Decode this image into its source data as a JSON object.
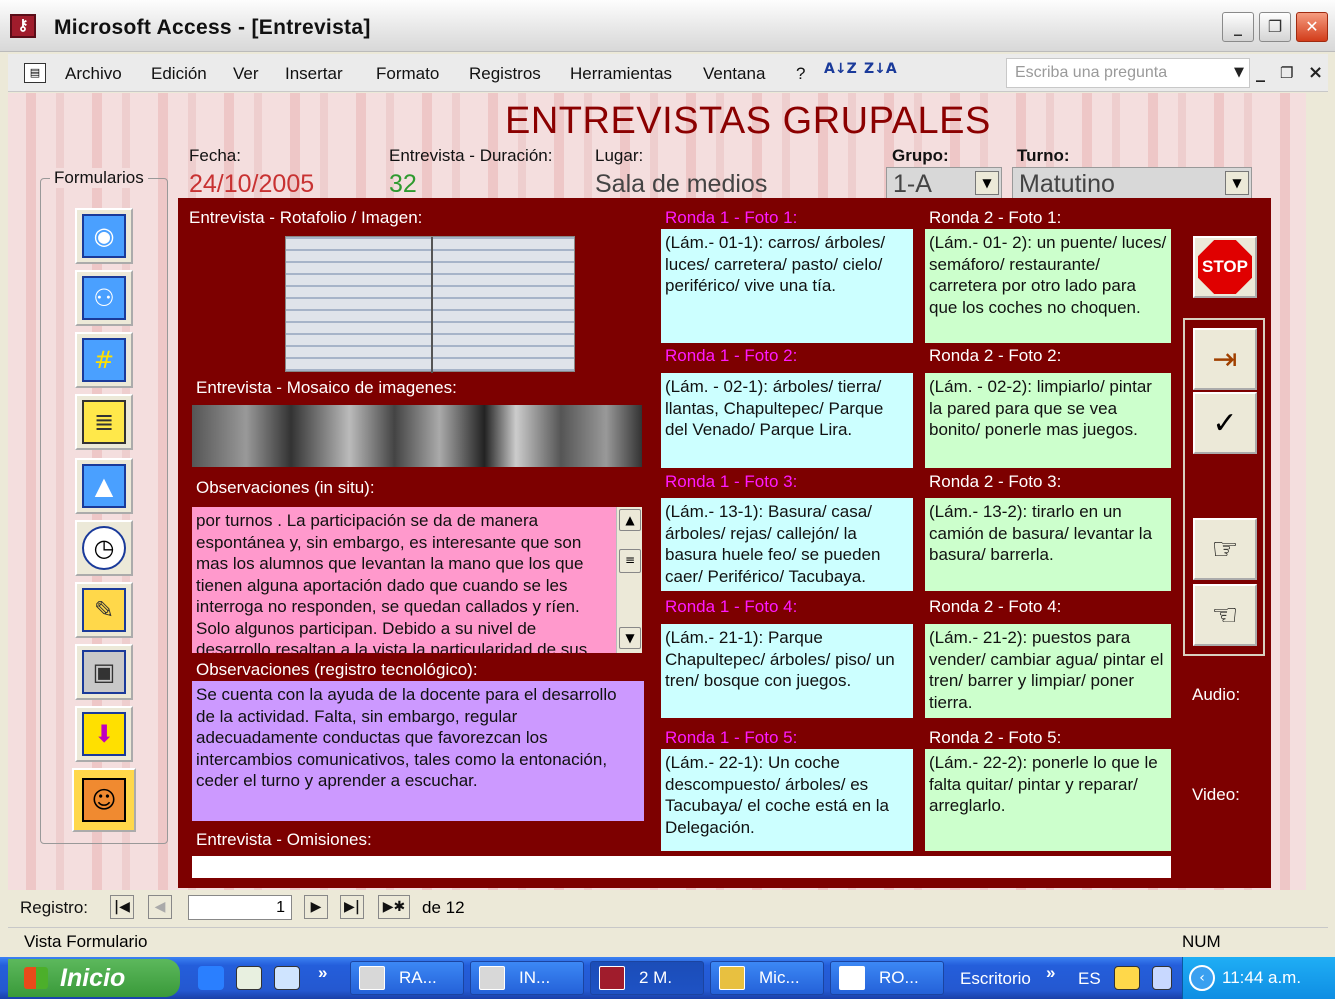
{
  "window": {
    "title": "Microsoft Access - [Entrevista]",
    "minimize": "_",
    "restore": "❐",
    "close": "✕"
  },
  "menubar": {
    "items": [
      "Archivo",
      "Edición",
      "Ver",
      "Insertar",
      "Formato",
      "Registros",
      "Herramientas",
      "Ventana",
      "?"
    ],
    "help_placeholder": "Escriba una pregunta",
    "sort_asc": "A↓Z",
    "sort_desc": "Z↓A"
  },
  "form": {
    "title": "ENTREVISTAS GRUPALES",
    "fecha_label": "Fecha:",
    "fecha_value": "24/10/2005",
    "duracion_label": "Entrevista - Duración:",
    "duracion_value": "32",
    "lugar_label": "Lugar:",
    "lugar_value": "Sala de medios",
    "grupo_label": "Grupo:",
    "grupo_value": "1-A",
    "turno_label": "Turno:",
    "turno_value": "Matutino",
    "sidebar_label": "Formularios",
    "rotafolio_label": "Entrevista - Rotafolio / Imagen:",
    "mosaico_label": "Entrevista - Mosaico de imagenes:",
    "obs_situ_label": "Observaciones (in situ):",
    "obs_situ_text": "por turnos . La participación se da de manera espontánea y, sin embargo, es interesante que son mas los alumnos que levantan la mano que los que tienen alguna aportación dado que cuando se les interroga no responden, se quedan callados y ríen. Solo algunos participan. Debido a su nivel de desarrollo resaltan a la vista la particularidad de sus",
    "obs_tec_label": "Observaciones (registro tecnológico):",
    "obs_tec_text": "Se cuenta con la ayuda de la docente para el desarrollo de la actividad. Falta, sin embargo, regular adecuadamente conductas que favorezcan los intercambios comunicativos, tales como la entonación, ceder el turno y aprender a escuchar.",
    "omisiones_label": "Entrevista - Omisiones:",
    "ronda1": [
      {
        "label": "Ronda 1 - Foto 1:",
        "text": "(Lám.- 01-1): carros/ árboles/ luces/ carretera/ pasto/ cielo/ periférico/ vive una tía."
      },
      {
        "label": "Ronda 1 - Foto 2:",
        "text": "(Lám. - 02-1): árboles/ tierra/ llantas, Chapultepec/ Parque del Venado/ Parque Lira."
      },
      {
        "label": "Ronda 1 - Foto 3:",
        "text": "(Lám.- 13-1): Basura/ casa/ árboles/ rejas/ callejón/ la basura huele feo/ se pueden caer/  Periférico/ Tacubaya."
      },
      {
        "label": "Ronda 1 - Foto 4:",
        "text": "(Lám.- 21-1): Parque Chapultepec/ árboles/ piso/ un tren/ bosque con juegos."
      },
      {
        "label": "Ronda 1 - Foto 5:",
        "text": "(Lám.- 22-1): Un coche descompuesto/ árboles/ es Tacubaya/ el coche está en la Delegación."
      }
    ],
    "ronda2": [
      {
        "label": "Ronda 2 - Foto 1:",
        "text": "(Lám.- 01- 2): un puente/ luces/ semáforo/ restaurante/ carretera por otro lado para que los coches no choquen."
      },
      {
        "label": "Ronda 2 - Foto 2:",
        "text": "(Lám. - 02-2): limpiarlo/ pintar la pared para que se vea bonito/ ponerle mas juegos."
      },
      {
        "label": "Ronda 2 - Foto 3:",
        "text": "(Lám.- 13-2): tirarlo en un camión de basura/ levantar la basura/ barrerla."
      },
      {
        "label": "Ronda 2 - Foto 4:",
        "text": "(Lám.- 21-2): puestos para vender/ cambiar agua/ pintar el tren/ barrer y limpiar/ poner tierra."
      },
      {
        "label": "Ronda 2 - Foto 5:",
        "text": "(Lám.- 22-2): ponerle lo que le falta quitar/ pintar y reparar/ arreglarlo."
      }
    ],
    "stop_label": "STOP",
    "audio_label": "Audio:",
    "video_label": "Video:"
  },
  "navigation": {
    "registro_label": "Registro:",
    "current": "1",
    "de_label": "de",
    "total": "12"
  },
  "status": {
    "left": "Vista Formulario",
    "right": "NUM"
  },
  "taskbar": {
    "start": "Inicio",
    "items": [
      "RA...",
      "IN...",
      "2 M.",
      "Mic...",
      "RO..."
    ],
    "desktop": "Escritorio",
    "lang": "ES",
    "clock": "11:44 a.m."
  },
  "colors": {
    "panel": "#7d0000",
    "title": "#8b0000",
    "ronda_label": "#ff1aff",
    "cyan": "#ccffff",
    "green": "#ccffcc",
    "pink": "#ff99cc",
    "lavender": "#cc99ff"
  }
}
